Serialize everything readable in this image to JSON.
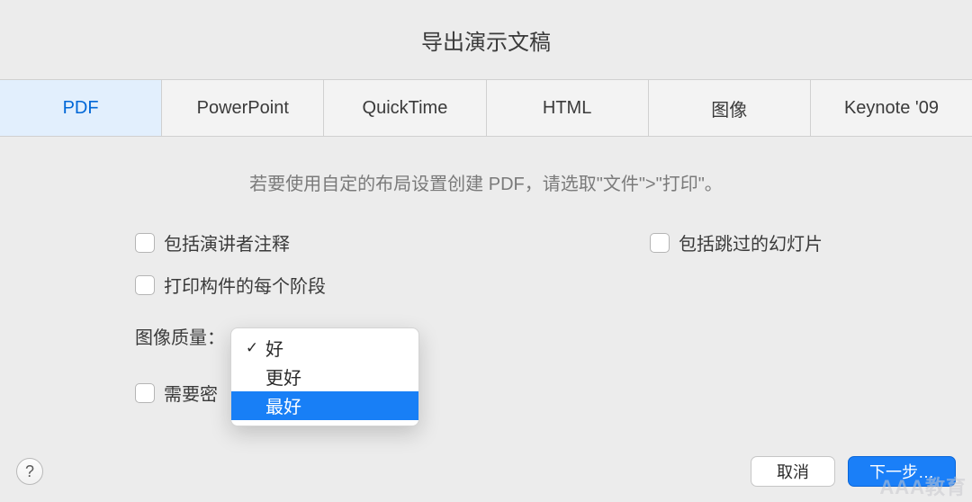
{
  "title": "导出演示文稿",
  "tabs": [
    {
      "label": "PDF",
      "active": true
    },
    {
      "label": "PowerPoint"
    },
    {
      "label": "QuickTime"
    },
    {
      "label": "HTML"
    },
    {
      "label": "图像"
    },
    {
      "label": "Keynote '09"
    }
  ],
  "hint": "若要使用自定的布局设置创建 PDF，请选取\"文件\">\"打印\"。",
  "checkboxes": {
    "presenter_notes": "包括演讲者注释",
    "skipped_slides": "包括跳过的幻灯片",
    "print_stages": "打印构件的每个阶段",
    "require_password": "需要密"
  },
  "quality": {
    "label": "图像质量：",
    "options": [
      {
        "label": "好",
        "checked": true
      },
      {
        "label": "更好"
      },
      {
        "label": "最好",
        "highlight": true
      }
    ]
  },
  "footer": {
    "help": "?",
    "cancel": "取消",
    "next": "下一步…"
  },
  "watermark": "AAA教育"
}
